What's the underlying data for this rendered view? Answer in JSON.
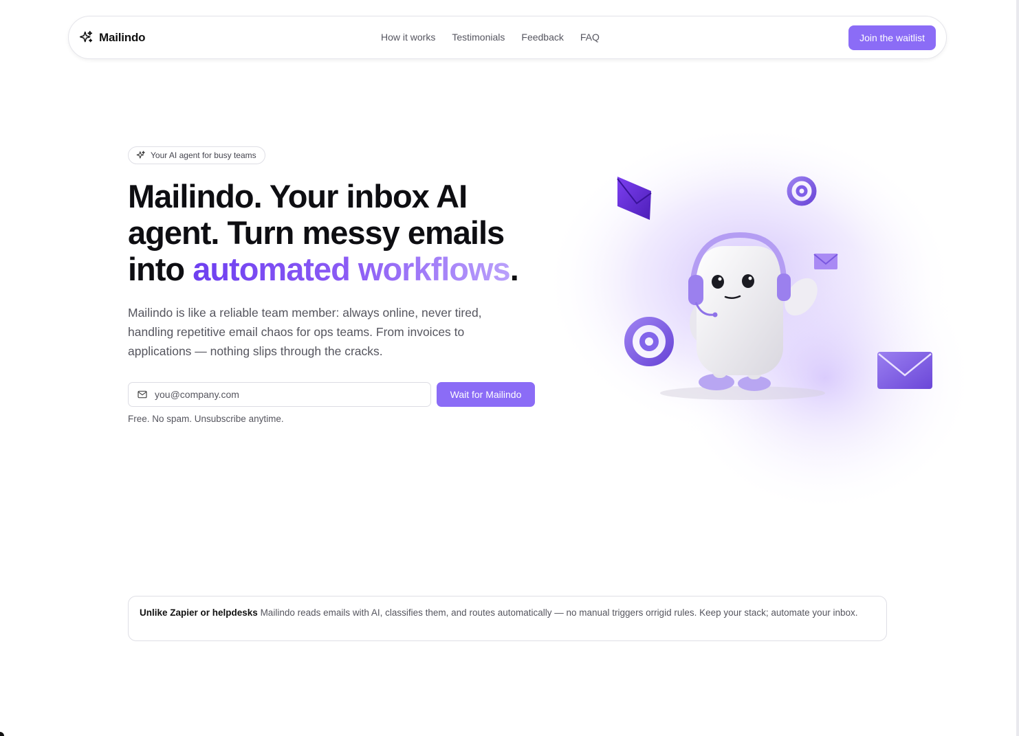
{
  "nav": {
    "brand": "Mailindo",
    "links": [
      "How it works",
      "Testimonials",
      "Feedback",
      "FAQ"
    ],
    "cta": "Join the waitlist"
  },
  "hero": {
    "badge": "Your AI agent for busy teams",
    "headline_plain": "Mailindo. Your inbox AI agent. Turn messy emails into ",
    "headline_accent": "automated workflows",
    "headline_end": ".",
    "subtext": "Mailindo is like a reliable team member: always online, never tired, handling repetitive email chaos for ops teams. From invoices to applications — nothing slips through the cracks.",
    "email_placeholder": "you@company.com",
    "submit": "Wait for Mailindo",
    "fineprint": "Free. No spam. Unsubscribe anytime."
  },
  "note": {
    "lead": "Unlike Zapier or helpdesks",
    "body": " Mailindo reads emails with AI, classifies them, and routes automatically — no manual triggers orrigid rules. Keep your stack; automate your inbox."
  },
  "colors": {
    "accent": "#8b6cf6",
    "accent_dark": "#6d3ff0",
    "text": "#0e0e12",
    "muted": "#55555e"
  },
  "icons": {
    "brand": "sparkle-icon",
    "badge": "sparkle-icon",
    "email": "mail-icon"
  }
}
